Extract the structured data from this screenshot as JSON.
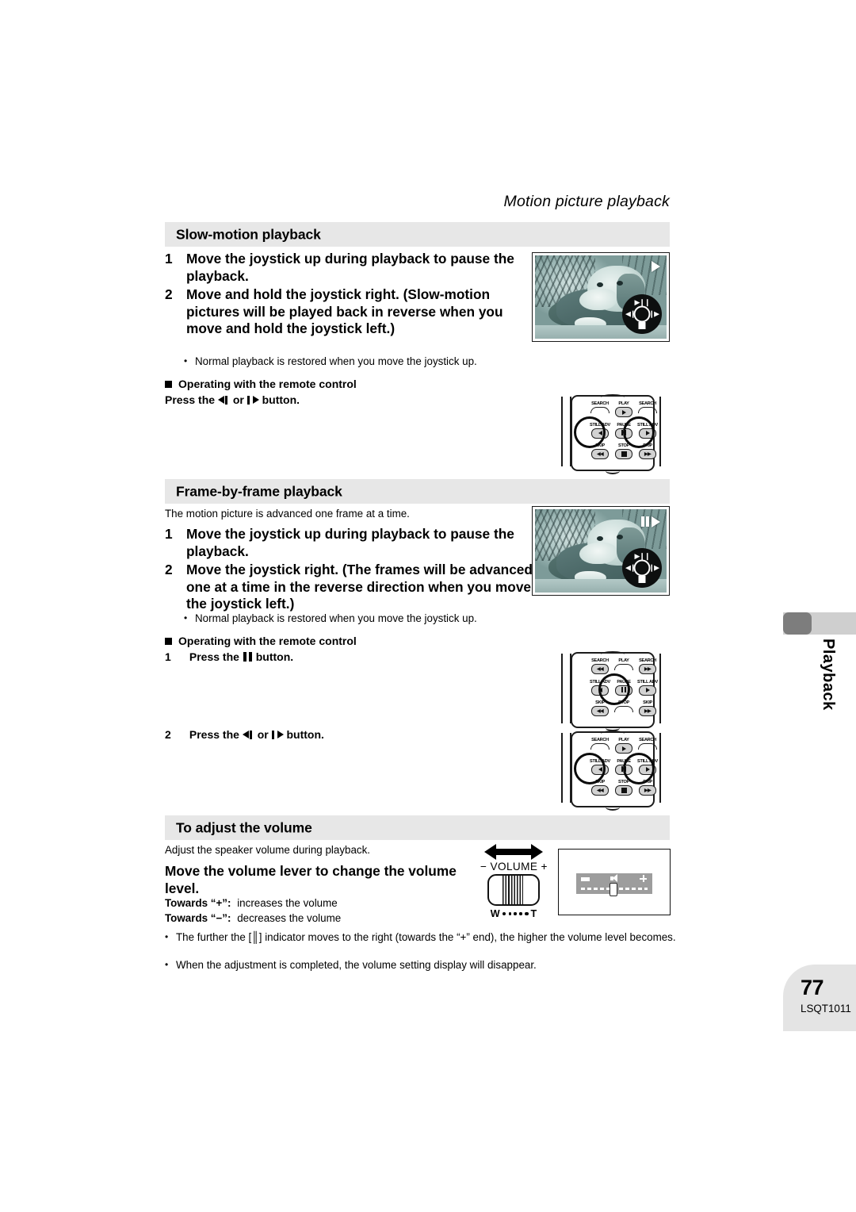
{
  "running_head": "Motion picture playback",
  "sections": [
    {
      "title": "Slow-motion playback",
      "steps": [
        {
          "num": "1",
          "text": "Move the joystick up during playback to pause the playback."
        },
        {
          "num": "2",
          "text": "Move and hold the joystick right.",
          "paren": "(Slow-motion pictures will be played back in reverse when you move and hold the joystick left.)"
        }
      ],
      "note": "Normal playback is restored when you move the joystick up.",
      "remote_head": "Operating with the remote control",
      "remote_instruction_pre": "Press the",
      "remote_instruction_mid": "or",
      "remote_instruction_post": "button."
    },
    {
      "title": "Frame-by-frame playback",
      "lead": "The motion picture is advanced one frame at a time.",
      "steps": [
        {
          "num": "1",
          "text": "Move the joystick up during playback to pause the playback."
        },
        {
          "num": "2",
          "text": "Move the joystick right.",
          "paren": "(The frames will be advanced one at a time in the reverse direction when you move the joystick left.)"
        }
      ],
      "note": "Normal playback is restored when you move the joystick up.",
      "remote_head": "Operating with the remote control",
      "remote_step_1_num": "1",
      "remote_step_1_pre": "Press the",
      "remote_step_1_post": "button.",
      "remote_step_2_num": "2",
      "remote_step_2_pre": "Press the",
      "remote_step_2_mid": "or",
      "remote_step_2_post": "button."
    },
    {
      "title": "To adjust the volume",
      "lead": "Adjust the speaker volume during playback.",
      "heading": "Move the volume lever to change the volume level.",
      "towards_plus_label": "Towards “+”:",
      "towards_plus_text": "increases the volume",
      "towards_minus_label": "Towards “−”:",
      "towards_minus_text": "decreases the volume",
      "bullets": [
        "The further the [║] indicator moves to the right (towards the “+” end), the higher the volume level becomes.",
        "When the adjustment is completed, the volume setting display will disappear."
      ]
    }
  ],
  "remote": {
    "keys": [
      {
        "label": "SEARCH",
        "icon": "rewind"
      },
      {
        "label": "PLAY",
        "icon": "play"
      },
      {
        "label": "SEARCH",
        "icon": "fast-forward"
      },
      {
        "label": "STILL ADV",
        "icon": "still-adv-left"
      },
      {
        "label": "PAUSE",
        "icon": "pause"
      },
      {
        "label": "STILL ADV",
        "icon": "still-adv-right"
      },
      {
        "label": "SKIP",
        "icon": "skip-back"
      },
      {
        "label": "STOP",
        "icon": "stop"
      },
      {
        "label": "SKIP",
        "icon": "skip-forward"
      }
    ]
  },
  "volume_lever": {
    "minus": "−",
    "name": "VOLUME",
    "plus": "+",
    "wide_label": "W",
    "tele_label": "T"
  },
  "side_tab": {
    "label": "Playback"
  },
  "footer": {
    "page_number": "77",
    "document_code": "LSQT1011"
  },
  "colors": {
    "band": "#e7e7e7",
    "tab_bar": "#cfcfcf",
    "tab_cap": "#7d7d7d",
    "footer": "#e4e4e4",
    "text": "#000000"
  }
}
